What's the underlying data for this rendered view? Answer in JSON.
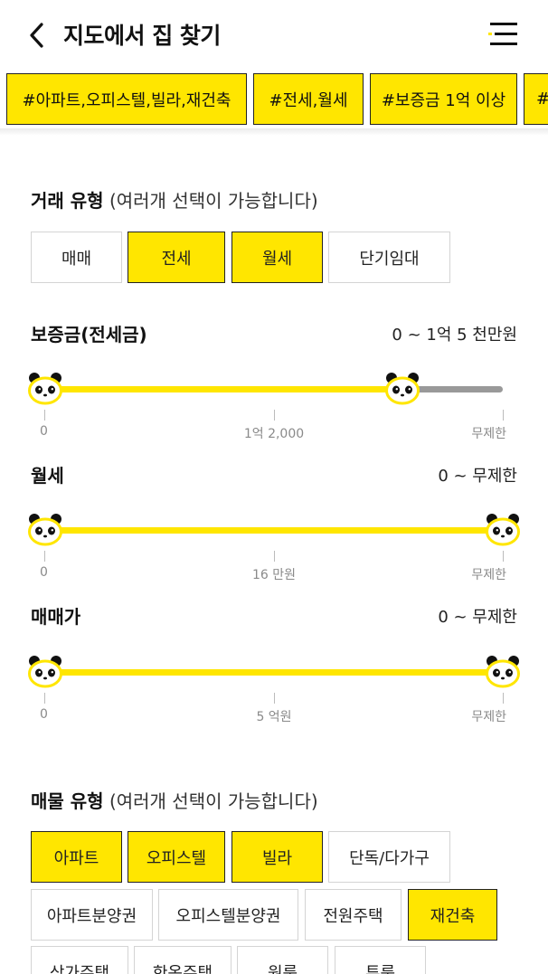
{
  "header": {
    "title": "지도에서 집 찾기"
  },
  "tags": [
    "#아파트,오피스텔,빌라,재건축",
    "#전세,월세",
    "#보증금 1억 이상",
    "#..."
  ],
  "trade_type": {
    "title": "거래 유형",
    "note": "(여러개 선택이 가능합니다)",
    "options": [
      {
        "label": "매매",
        "selected": false
      },
      {
        "label": "전세",
        "selected": true
      },
      {
        "label": "월세",
        "selected": true
      },
      {
        "label": "단기임대",
        "selected": false
      }
    ]
  },
  "deposit": {
    "label": "보증금(전세금)",
    "value": "0 ~ 1억 5 천만원",
    "ticks": [
      "0",
      "1억 2,000",
      "무제한"
    ],
    "range_fraction": [
      0,
      0.78
    ]
  },
  "monthly_rent": {
    "label": "월세",
    "value": "0 ~ 무제한",
    "ticks": [
      "0",
      "16 만원",
      "무제한"
    ],
    "range_fraction": [
      0,
      1
    ]
  },
  "sale_price": {
    "label": "매매가",
    "value": "0 ~ 무제한",
    "ticks": [
      "0",
      "5 억원",
      "무제한"
    ],
    "range_fraction": [
      0,
      1
    ]
  },
  "property_type": {
    "title": "매물 유형",
    "note": "(여러개 선택이 가능합니다)",
    "options": [
      {
        "label": "아파트",
        "selected": true
      },
      {
        "label": "오피스텔",
        "selected": true
      },
      {
        "label": "빌라",
        "selected": true
      },
      {
        "label": "단독/다가구",
        "selected": false
      },
      {
        "label": "아파트분양권",
        "selected": false
      },
      {
        "label": "오피스텔분양권",
        "selected": false
      },
      {
        "label": "전원주택",
        "selected": false
      },
      {
        "label": "재건축",
        "selected": true
      },
      {
        "label": "상가주택",
        "selected": false
      },
      {
        "label": "한옥주택",
        "selected": false
      },
      {
        "label": "원룸",
        "selected": false
      },
      {
        "label": "투룸",
        "selected": false
      }
    ]
  },
  "colors": {
    "accent": "#ffe600",
    "track_inactive": "#999999"
  },
  "icons": {
    "back": "chevron-left-icon",
    "menu": "hamburger-menu-icon",
    "slider_thumb": "panda-face-icon"
  }
}
